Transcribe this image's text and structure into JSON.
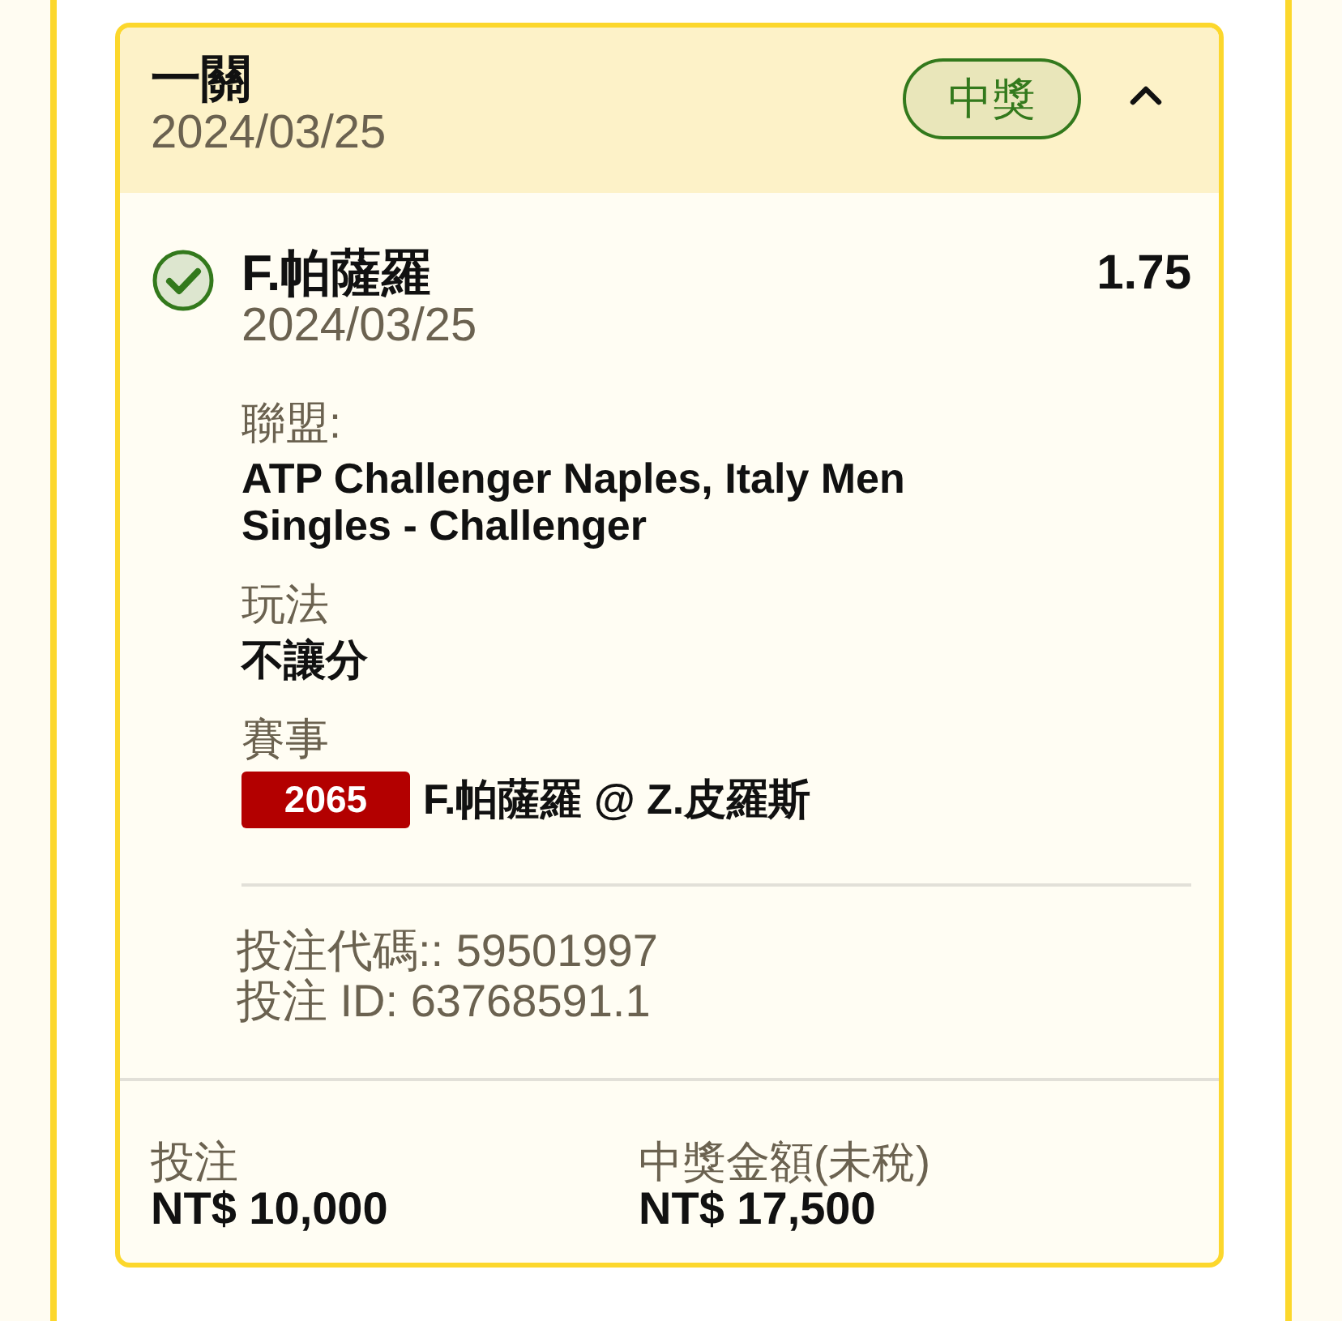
{
  "ticket": {
    "title": "一關",
    "date": "2024/03/25",
    "status": {
      "kind": "won",
      "label": "中獎"
    },
    "expanded": true
  },
  "selections": [
    {
      "kind": "won",
      "name": "F.帕薩羅",
      "odds": "1.75",
      "date": "2024/03/25",
      "details": [
        {
          "kind": "text",
          "label": "聯盟:",
          "value": "ATP Challenger Naples, Italy Men Singles - Challenger"
        },
        {
          "kind": "text",
          "label": "玩法",
          "value": "不讓分"
        },
        {
          "kind": "event",
          "label": "賽事",
          "code": "2065",
          "value": "F.帕薩羅 @ Z.皮羅斯"
        }
      ]
    }
  ],
  "bet_codes": [
    "投注代碼:: 59501997",
    "投注 ID: 63768591.1"
  ],
  "footer": [
    {
      "label": "投注",
      "value": "NT$ 10,000"
    },
    {
      "label": "中獎金額(未稅)",
      "value": "NT$ 17,500"
    }
  ]
}
